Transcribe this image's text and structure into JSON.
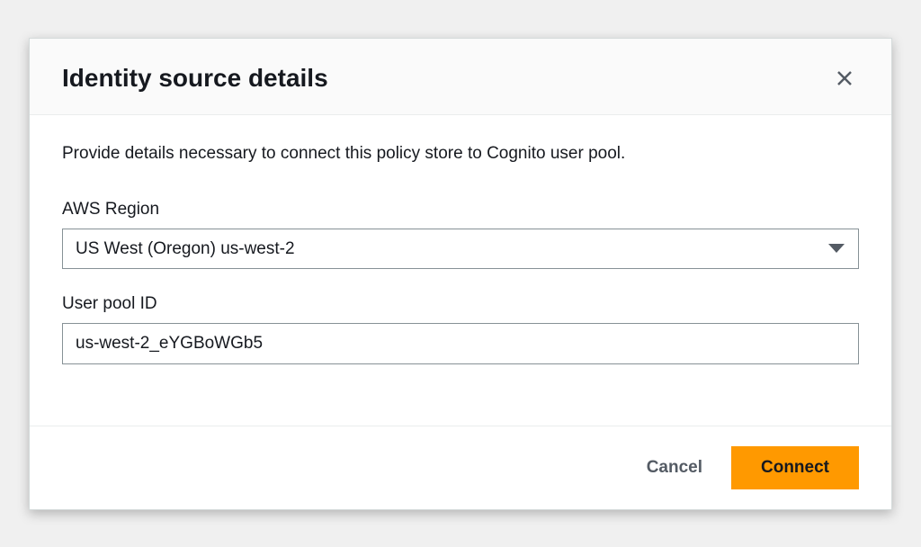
{
  "modal": {
    "title": "Identity source details",
    "description": "Provide details necessary to connect this policy store to Cognito user pool."
  },
  "fields": {
    "region": {
      "label": "AWS Region",
      "value": "US West (Oregon) us-west-2"
    },
    "userPoolId": {
      "label": "User pool ID",
      "value": "us-west-2_eYGBoWGb5"
    }
  },
  "footer": {
    "cancel": "Cancel",
    "connect": "Connect"
  }
}
